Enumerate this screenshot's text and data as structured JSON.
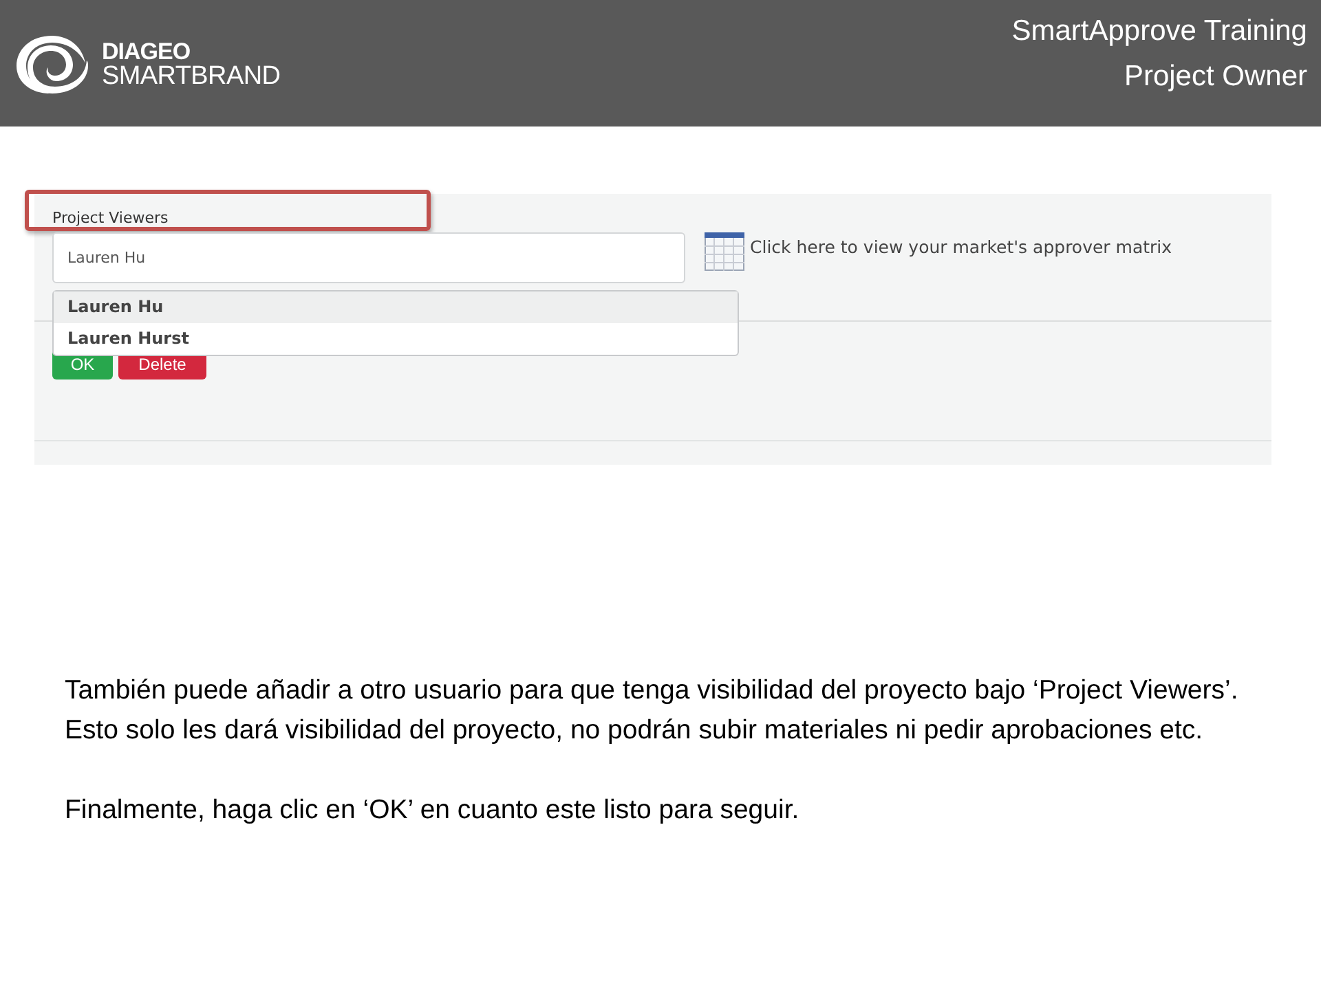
{
  "header": {
    "logo": {
      "brand": "DIAGEO",
      "product": "SMARTBRAND"
    },
    "title_lines": [
      "SmartApprove Training",
      "Project Owner"
    ]
  },
  "screenshot": {
    "field_label": "Project Viewers",
    "highlighted": true,
    "input_value": "Lauren Hu",
    "matrix_link": "Click here to view your market's approver matrix",
    "suggestions": [
      {
        "label": "Lauren Hu",
        "selected": true
      },
      {
        "label": "Lauren Hurst",
        "selected": false
      }
    ],
    "buttons": [
      {
        "label": "OK",
        "kind": "confirm"
      },
      {
        "label": "Delete",
        "kind": "danger"
      }
    ]
  },
  "paragraphs": [
    "También puede añadir a otro usuario para que tenga visibilidad del proyecto bajo ‘Project Viewers’.  Esto solo les dará visibilidad del proyecto, no podrán subir materiales ni pedir aprobaciones etc.",
    "Finalmente, haga clic en ‘OK’ en cuanto este listo para seguir."
  ]
}
